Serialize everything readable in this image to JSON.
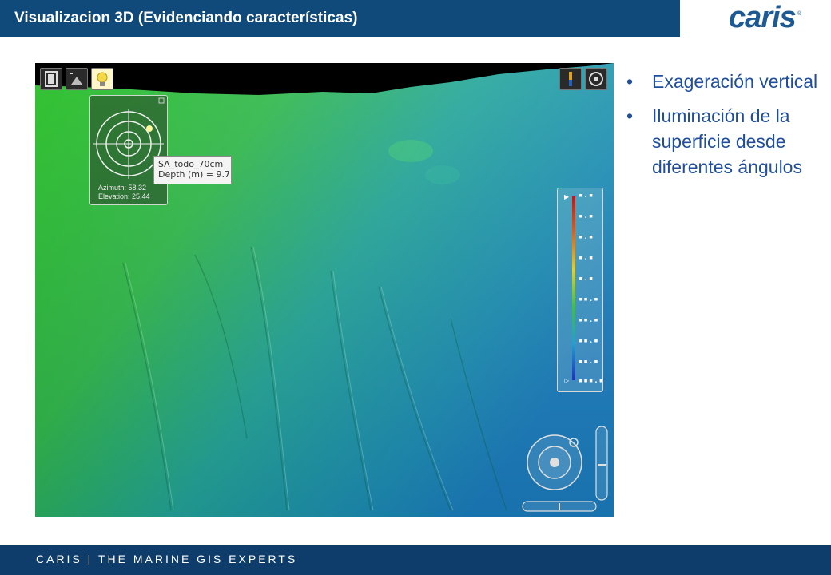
{
  "header": {
    "title": "Visualizacion 3D (Evidenciando características)",
    "logo_text": "caris",
    "logo_mark": "®",
    "brand_color": "#0f4a7a"
  },
  "viewer": {
    "toolbar": [
      {
        "icon": "film-strip-icon"
      },
      {
        "icon": "terrain-view-icon"
      },
      {
        "icon": "light-bulb-icon"
      }
    ],
    "top_right_icons": [
      {
        "icon": "color-legend-icon"
      },
      {
        "icon": "camera-record-icon"
      }
    ],
    "compass": {
      "azimuth": "Azimuth: 58.32",
      "elevation": "Elevation: 25.44"
    },
    "tooltip": {
      "surface_name": "SA_todo_70cm",
      "depth": "Depth (m) = 9.7"
    },
    "legend": {
      "labels": [
        "▪.▪",
        "▪.▪",
        "▪.▪",
        "▪.▪",
        "▪.▪",
        "▪▪.▪",
        "▪▪.▪",
        "▪▪.▪",
        "▪▪.▪",
        "▪▪▪.▪"
      ],
      "colors": [
        "#d01010",
        "#e66010",
        "#e8d020",
        "#40c040",
        "#20a0d0",
        "#2030c0"
      ]
    }
  },
  "bullets": [
    "Exageración vertical",
    "Iluminación de la superficie desde diferentes ángulos"
  ],
  "footer": {
    "text": "CARIS | THE MARINE GIS EXPERTS"
  }
}
